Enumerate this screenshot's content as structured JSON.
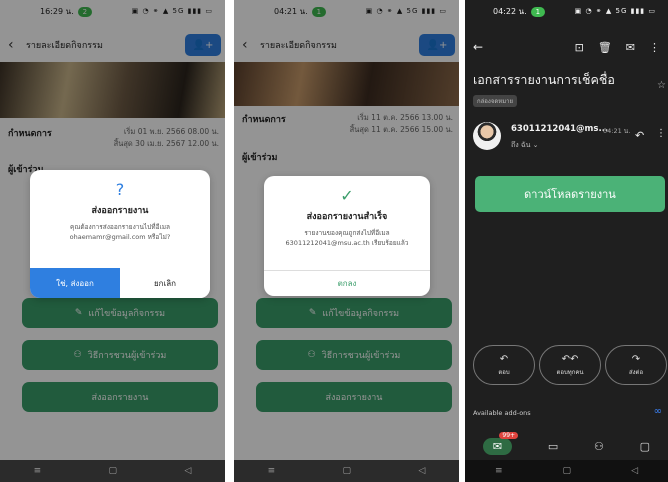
{
  "screen1": {
    "status_time": "16:29 น.",
    "status_pill": "2",
    "status_icons": "▣ ◔ ⚭ ▲ 5G ▮▮▮ ▭",
    "title": "รายละเอียดกิจกรรม",
    "schedule_label": "กำหนดการ",
    "schedule_start": "เริ่ม 01 พ.ย. 2566 08.00 น.",
    "schedule_end": "สิ้นสุด 30 เม.ย. 2567 12.00 น.",
    "participants_label": "ผู้เข้าร่วม",
    "dialog": {
      "icon": "?",
      "title": "ส่งออกรายงาน",
      "message": "คุณต้องการส่งออกรายงานไปที่อีเมล ohaemamr@gmail.com หรือไม่?",
      "confirm": "ใช่, ส่งออก",
      "cancel": "ยกเลิก"
    },
    "edit_button": "แก้ไขข้อมูลกิจกรรม",
    "invite_button": "วิธีการชวนผู้เข้าร่วม",
    "export_button": "ส่งออกรายงาน"
  },
  "screen2": {
    "status_time": "04:21 น.",
    "status_pill": "1",
    "status_icons": "▣ ◔ ⚭ ▲ 5G ▮▮▮ ▭",
    "title": "รายละเอียดกิจกรรม",
    "schedule_label": "กำหนดการ",
    "schedule_start": "เริ่ม 11 ต.ค. 2566 13.00 น.",
    "schedule_end": "สิ้นสุด 11 ต.ค. 2566 15.00 น.",
    "participants_label": "ผู้เข้าร่วม",
    "dialog": {
      "icon": "✓",
      "title": "ส่งออกรายงานสำเร็จ",
      "message": "รายงานของคุณถูกส่งไปที่อีเมล 63011212041@msu.ac.th เรียบร้อยแล้ว",
      "ok": "ตกลง"
    },
    "edit_button": "แก้ไขข้อมูลกิจกรรม",
    "invite_button": "วิธีการชวนผู้เข้าร่วม",
    "export_button": "ส่งออกรายงาน"
  },
  "screen3": {
    "status_time": "04:22 น.",
    "status_pill": "1",
    "status_icons": "▣ ◔ ⚭ ▲ 5G ▮▮▮ ▭",
    "subject": "เอกสารรายงานการเช็คชื่อ",
    "label": "กล่องจดหมาย",
    "sender": "63011212041@ms...",
    "time": "04:21 น.",
    "to": "ถึง ฉัน ⌄",
    "download_button": "ดาวน์โหลดรายงาน",
    "reply": "ตอบ",
    "reply_all": "ตอบทุกคน",
    "forward": "ส่งต่อ",
    "addons": "Available add-ons",
    "badge": "99+"
  }
}
